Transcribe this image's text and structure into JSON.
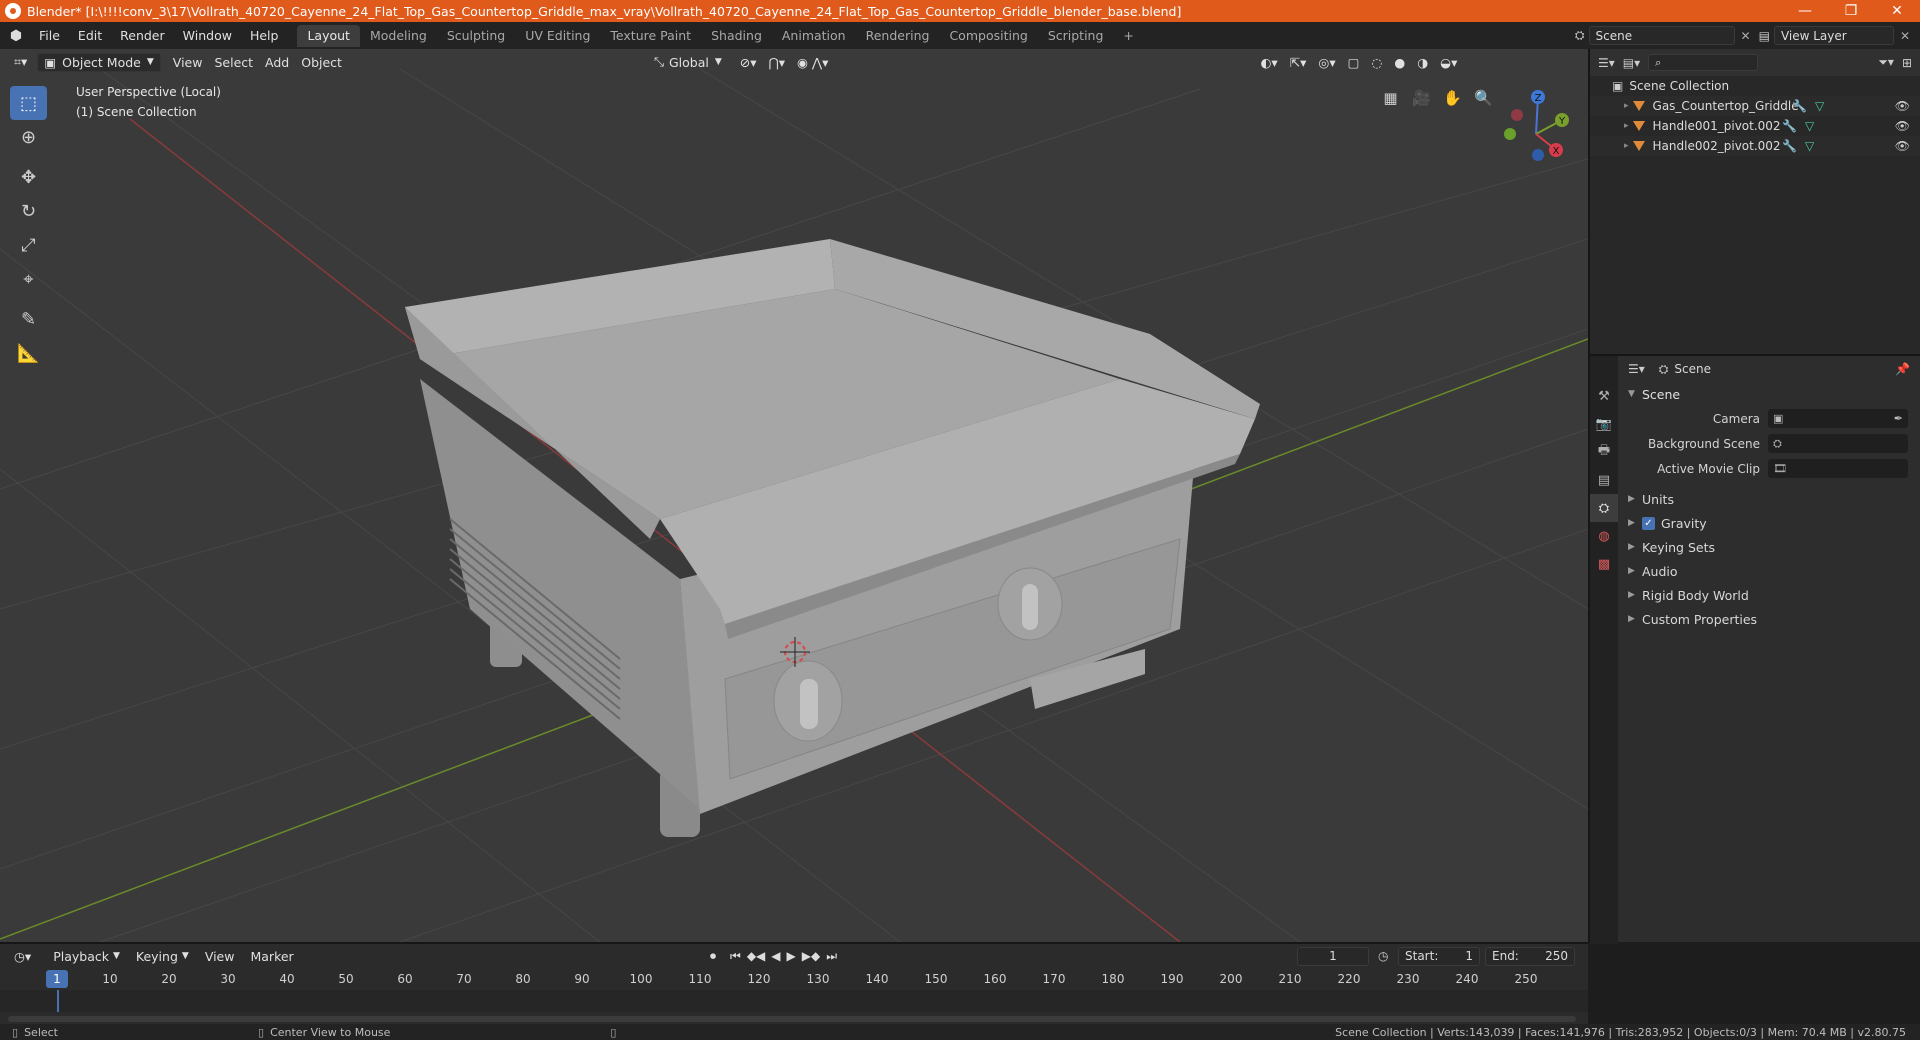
{
  "window": {
    "title": "Blender* [I:\\!!!!conv_3\\17\\Vollrath_40720_Cayenne_24_Flat_Top_Gas_Countertop_Griddle_max_vray\\Vollrath_40720_Cayenne_24_Flat_Top_Gas_Countertop_Griddle_blender_base.blend]",
    "minimize": "—",
    "maximize": "❐",
    "close": "✕"
  },
  "menus": [
    "File",
    "Edit",
    "Render",
    "Window",
    "Help"
  ],
  "workspaces": [
    "Layout",
    "Modeling",
    "Sculpting",
    "UV Editing",
    "Texture Paint",
    "Shading",
    "Animation",
    "Rendering",
    "Compositing",
    "Scripting"
  ],
  "workspace_add": "+",
  "scene_selector": {
    "value": "Scene"
  },
  "view_layer_selector": {
    "value": "View Layer"
  },
  "viewport": {
    "mode": "Object Mode",
    "menus": [
      "View",
      "Select",
      "Add",
      "Object"
    ],
    "orientation": "Global",
    "info_line1": "User Perspective (Local)",
    "info_line2": "(1) Scene Collection",
    "gizmo": {
      "x": "X",
      "y": "Y",
      "z": "Z"
    }
  },
  "outliner": {
    "root": "Scene Collection",
    "items": [
      "Gas_Countertop_Griddle",
      "Handle001_pivot.002",
      "Handle002_pivot.002"
    ]
  },
  "properties": {
    "header": "Scene",
    "panel": "Scene",
    "fields": [
      {
        "label": "Camera"
      },
      {
        "label": "Background Scene"
      },
      {
        "label": "Active Movie Clip"
      }
    ],
    "subpanels": [
      "Units",
      "Gravity",
      "Keying Sets",
      "Audio",
      "Rigid Body World",
      "Custom Properties"
    ],
    "gravity_checked": true
  },
  "timeline": {
    "menus": [
      "Playback",
      "Keying",
      "View",
      "Marker"
    ],
    "current_frame": "1",
    "start_label": "Start:",
    "start": "1",
    "end_label": "End:",
    "end": "250",
    "ruler": [
      "1",
      "10",
      "20",
      "30",
      "40",
      "50",
      "60",
      "70",
      "80",
      "90",
      "100",
      "110",
      "120",
      "130",
      "140",
      "150",
      "160",
      "170",
      "180",
      "190",
      "200",
      "210",
      "220",
      "230",
      "240",
      "250"
    ]
  },
  "status": {
    "left": "Select",
    "middle": "Center View to Mouse",
    "right": "Scene Collection | Verts:143,039 | Faces:141,976 | Tris:283,952 | Objects:0/3 | Mem: 70.4 MB | v2.80.75"
  },
  "colors": {
    "titlebar": "#e05a1b",
    "accent": "#4772b3",
    "viewport_bg": "#3c3c3c",
    "object_orange": "#e08a3a"
  }
}
